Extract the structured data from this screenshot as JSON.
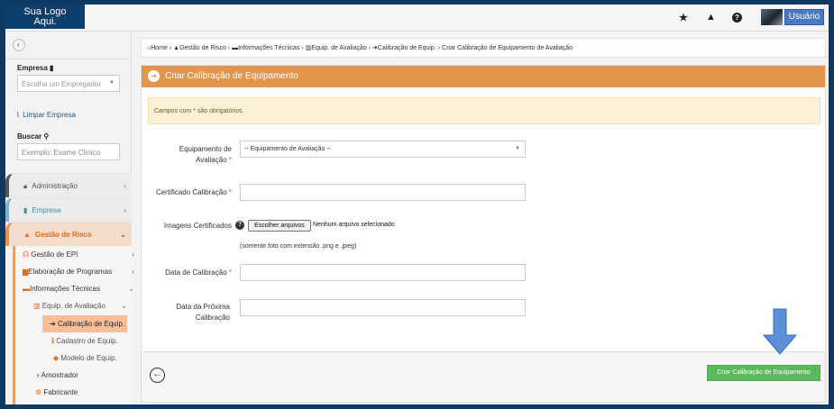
{
  "logo": {
    "line1": "Sua Logo",
    "line2": "Aqui."
  },
  "topbar": {
    "icons": [
      "star-icon",
      "warning-icon",
      "help-icon"
    ],
    "user_label": "Usuário"
  },
  "sidebar": {
    "empresa_label": "Empresa",
    "empresa_placeholder": "Escolha um Empregador",
    "limpar_label": "Limpar Empresa",
    "buscar_label": "Buscar",
    "buscar_placeholder": "Exemplo: Exame Clínico",
    "menu": [
      {
        "label": "Administração",
        "icon": "lock-icon"
      },
      {
        "label": "Empresa",
        "icon": "building-icon"
      },
      {
        "label": "Gestão de Risco",
        "icon": "warning-icon"
      }
    ],
    "submenu": [
      {
        "label": "Gestão de EPI",
        "icon": "headset-icon"
      },
      {
        "label": "Elaboração de Programas",
        "icon": "book-icon"
      },
      {
        "label": "Informações Técnicas",
        "icon": "folder-open-icon"
      },
      {
        "label": "Equip. de Avaliação",
        "icon": "chart-icon"
      },
      {
        "label": "Calibração de Equip.",
        "icon": "sign-in-icon"
      },
      {
        "label": "Cadastro de Equip.",
        "icon": "info-icon"
      },
      {
        "label": "Modelo de Equip.",
        "icon": "tag-icon"
      },
      {
        "label": "Amostrador",
        "icon": "circle-half-icon"
      },
      {
        "label": "Fabricante",
        "icon": "cogs-icon"
      }
    ]
  },
  "breadcrumb": {
    "items": [
      "Home",
      "Gestão de Risco",
      "Informações Técnicas",
      "Equip. de Avaliação",
      "Calibração de Equip.",
      "Criar Calibração de Equipamento de Avaliação"
    ]
  },
  "panel": {
    "title": "Criar Calibração de Equipamento",
    "alert": "Campos com * são obrigatórios.",
    "fields": {
      "equipamento_label_1": "Equipamento de",
      "equipamento_label_2": "Avaliação",
      "equipamento_value": "-- Equipamento de Avaliação --",
      "certificado_label": "Certificado Calibração",
      "imagens_label": "Imagens Certificados",
      "file_button": "Escolher arquivos",
      "file_status": "Nenhum arquivo selecionado",
      "file_hint": "(somente foto com extensão .png e .jpeg)",
      "data_calibracao_label": "Data de Calibração",
      "data_proxima_label_1": "Data da Próxima",
      "data_proxima_label_2": "Calibração"
    },
    "required_mark": "*",
    "submit_label": "Criar Calibração de Equipamento"
  },
  "colors": {
    "accent_orange": "#e4954d",
    "submit_green": "#5cb85c",
    "annotation_arrow": "#5b8fd6"
  }
}
